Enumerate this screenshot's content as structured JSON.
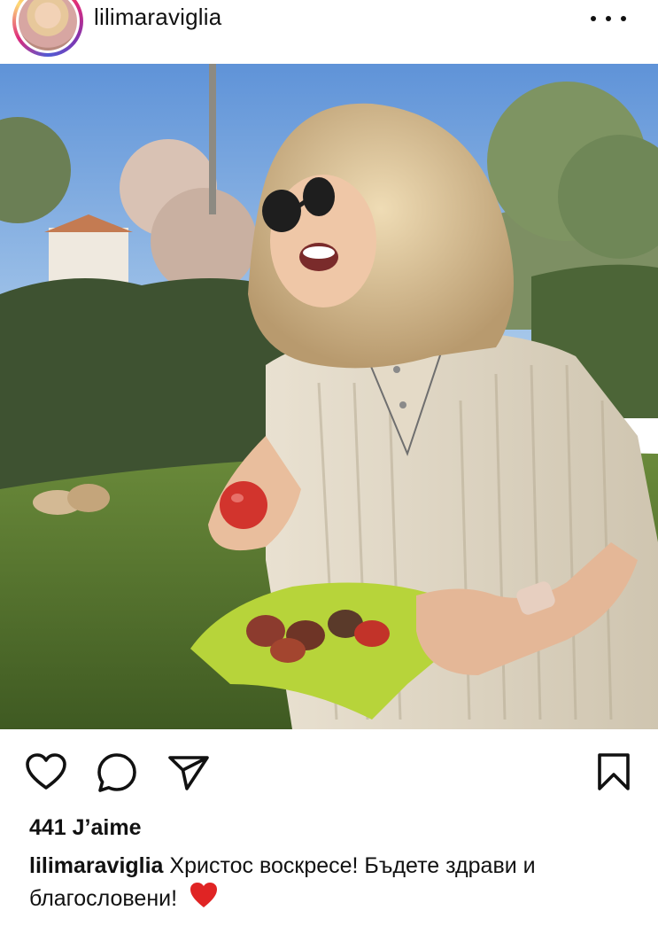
{
  "header": {
    "username": "lilimaraviglia",
    "more_icon": "more-horizontal-icon"
  },
  "post": {
    "image_description_icon": "photo",
    "actions": {
      "like_icon": "heart-icon",
      "comment_icon": "comment-icon",
      "share_icon": "send-icon",
      "save_icon": "bookmark-icon"
    },
    "likes_text": "441 J’aime",
    "caption": {
      "username": "lilimaraviglia",
      "text": "Христос воскресе! Бъдете здрави и благословени!",
      "emoji_icon": "red-heart-icon"
    }
  },
  "colors": {
    "ring_gradient": [
      "#f58529",
      "#dd2a7b",
      "#8134af",
      "#515bd4"
    ],
    "heart_red": "#e02424"
  }
}
